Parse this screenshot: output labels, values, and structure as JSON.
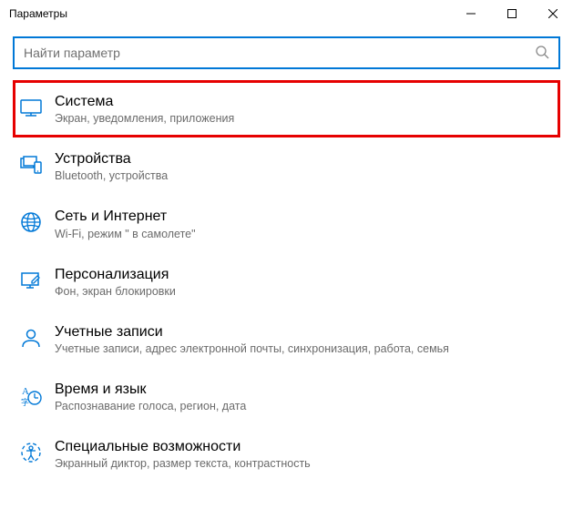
{
  "window": {
    "title": "Параметры"
  },
  "search": {
    "placeholder": "Найти параметр"
  },
  "items": [
    {
      "title": "Система",
      "subtitle": "Экран, уведомления, приложения",
      "icon": "monitor",
      "highlight": true
    },
    {
      "title": "Устройства",
      "subtitle": "Bluetooth, устройства",
      "icon": "devices",
      "highlight": false
    },
    {
      "title": "Сеть и Интернет",
      "subtitle": "Wi-Fi, режим \" в самолете\"",
      "icon": "globe",
      "highlight": false
    },
    {
      "title": "Персонализация",
      "subtitle": "Фон, экран блокировки",
      "icon": "personalize",
      "highlight": false
    },
    {
      "title": "Учетные записи",
      "subtitle": "Учетные записи, адрес электронной почты, синхронизация, работа, семья",
      "icon": "account",
      "highlight": false
    },
    {
      "title": "Время и язык",
      "subtitle": "Распознавание голоса, регион, дата",
      "icon": "timelang",
      "highlight": false
    },
    {
      "title": "Специальные возможности",
      "subtitle": "Экранный диктор, размер текста, контрастность",
      "icon": "ease",
      "highlight": false
    }
  ]
}
